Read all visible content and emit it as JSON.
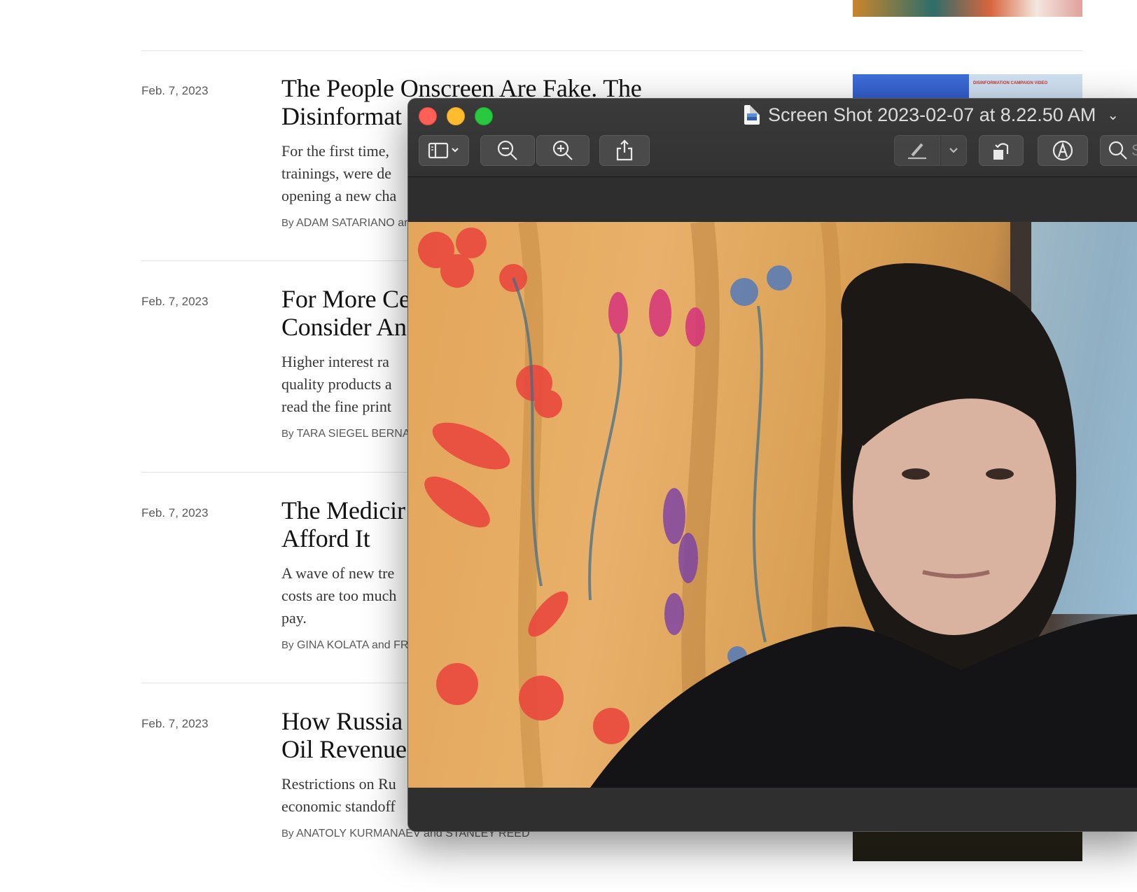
{
  "articles": [
    {
      "date": "Feb. 7, 2023",
      "title": "The People Onscreen Are Fake. The Disinformat",
      "summary": "For the first time, trainings, were de opening a new cha",
      "byline_prefix": "By",
      "byline_names": "ADAM SATARIANO ar"
    },
    {
      "date": "Feb. 7, 2023",
      "title": "For More Ce Consider An",
      "summary": "Higher interest ra quality products a read the fine print",
      "byline_prefix": "By",
      "byline_names": "TARA SIEGEL BERNA"
    },
    {
      "date": "Feb. 7, 2023",
      "title": "The Medicir Afford It",
      "summary": "A wave of new tre costs are too much pay.",
      "byline_prefix": "By",
      "byline_names": "GINA KOLATA and FR"
    },
    {
      "date": "Feb. 7, 2023",
      "title": "How Russia Oil Revenue",
      "summary": "Restrictions on Ru economic standoff",
      "byline_prefix": "By",
      "byline_names": "ANATOLY KURMANAEV and STANLEY REED"
    }
  ],
  "thumbnail_caption": "DISINFORMATION CAMPAIGN VIDEO",
  "preview": {
    "window_title": "Screen Shot 2023-02-07 at 8.22.50 AM",
    "title_chevron": "⌄",
    "search_placeholder": "S"
  },
  "icons": {
    "doc": "document-icon",
    "sidebar": "sidebar-icon",
    "zoom_out": "zoom-out-icon",
    "zoom_in": "zoom-in-icon",
    "share": "share-icon",
    "markup": "pen-icon",
    "rotate": "rotate-icon",
    "annotate": "markup-icon",
    "search": "search-icon"
  }
}
